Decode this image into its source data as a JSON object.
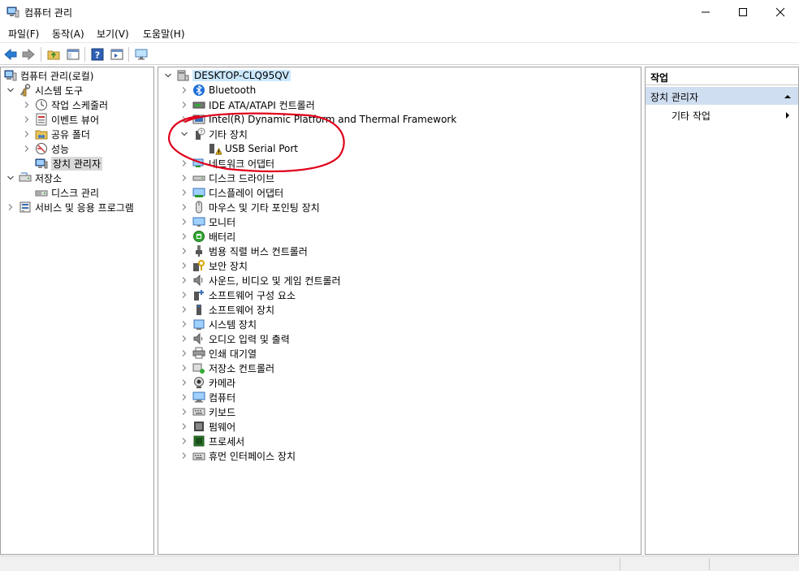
{
  "window": {
    "title": "컴퓨터 관리"
  },
  "menu": [
    "파일(F)",
    "동작(A)",
    "보기(V)",
    "도움말(H)"
  ],
  "left_tree": {
    "root": "컴퓨터 관리(로컬)",
    "system_tools": "시스템 도구",
    "task_scheduler": "작업 스케줄러",
    "event_viewer": "이벤트 뷰어",
    "shared_folders": "공유 폴더",
    "performance": "성능",
    "device_manager": "장치 관리자",
    "storage": "저장소",
    "disk_management": "디스크 관리",
    "services_apps": "서비스 및 응용 프로그램"
  },
  "devices": {
    "computer_name": "DESKTOP-CLQ95QV",
    "categories": [
      "Bluetooth",
      "IDE ATA/ATAPI 컨트롤러",
      "Intel(R) Dynamic Platform and Thermal Framework",
      "기타 장치",
      "네트워크 어댑터",
      "디스크 드라이브",
      "디스플레이 어댑터",
      "마우스 및 기타 포인팅 장치",
      "모니터",
      "배터리",
      "범용 직렬 버스 컨트롤러",
      "보안 장치",
      "사운드, 비디오 및 게임 컨트롤러",
      "소프트웨어 구성 요소",
      "소프트웨어 장치",
      "시스템 장치",
      "오디오 입력 및 출력",
      "인쇄 대기열",
      "저장소 컨트롤러",
      "카메라",
      "컴퓨터",
      "키보드",
      "펌웨어",
      "프로세서",
      "휴먼 인터페이스 장치"
    ],
    "other_device_child": "USB Serial Port"
  },
  "actions": {
    "header": "작업",
    "section": "장치 관리자",
    "more": "기타 작업"
  },
  "colors": {
    "annotation": "#e0001b",
    "selection": "#d9d9d9",
    "highlight": "#cce8ff",
    "actions_section": "#cfdef0"
  }
}
